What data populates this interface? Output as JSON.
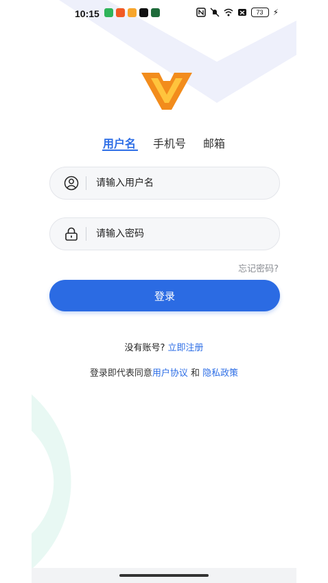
{
  "status_bar": {
    "time": "10:15",
    "battery": "73",
    "app_icons": [
      {
        "name": "green-app-icon",
        "color": "#2fb45a"
      },
      {
        "name": "orange-play-icon",
        "color": "#f15a24"
      },
      {
        "name": "colorful-app-icon",
        "color": "#f7a52c"
      },
      {
        "name": "tiktok-icon",
        "color": "#111111"
      },
      {
        "name": "dark-green-app-icon",
        "color": "#1e6b3a"
      }
    ]
  },
  "tabs": [
    {
      "label": "用户名",
      "active": true
    },
    {
      "label": "手机号",
      "active": false
    },
    {
      "label": "邮箱",
      "active": false
    }
  ],
  "username": {
    "placeholder": "请输入用户名",
    "value": ""
  },
  "password": {
    "placeholder": "请输入密码",
    "value": ""
  },
  "forgot_password": "忘记密码?",
  "login_button": "登录",
  "register": {
    "prompt": "没有账号?",
    "link": "立即注册"
  },
  "agreement": {
    "prefix": "登录即代表同意",
    "user_agreement": "用户协议",
    "and": "和",
    "privacy_policy": "隐私政策"
  },
  "colors": {
    "accent": "#2b6be3",
    "logo_orange": "#f28c1c"
  }
}
